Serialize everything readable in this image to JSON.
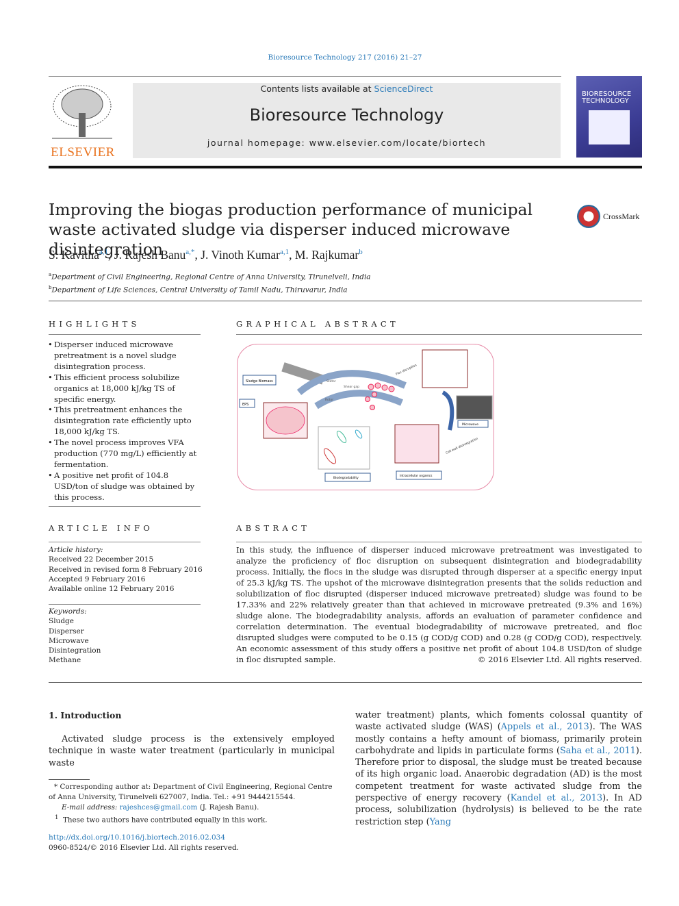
{
  "header": {
    "citation": "Bioresource Technology 217 (2016) 21–27",
    "contents_prefix": "Contents lists available at ",
    "contents_link": "ScienceDirect",
    "journal_title": "Bioresource Technology",
    "homepage": "journal homepage: www.elsevier.com/locate/biortech",
    "publisher_logo": "ELSEVIER",
    "cover_title": "BIORESOURCE TECHNOLOGY",
    "crossmark": "CrossMark"
  },
  "article": {
    "title": "Improving the biogas production performance of municipal waste activated sludge via disperser induced microwave disintegration",
    "authors": [
      {
        "name": "S. Kavitha",
        "sup": "a,1"
      },
      {
        "name": "J. Rajesh Banu",
        "sup": "a,*"
      },
      {
        "name": "J. Vinoth Kumar",
        "sup": "a,1"
      },
      {
        "name": "M. Rajkumar",
        "sup": "b"
      }
    ],
    "affiliations": [
      {
        "mark": "a",
        "text": "Department of Civil Engineering, Regional Centre of Anna University, Tirunelveli, India"
      },
      {
        "mark": "b",
        "text": "Department of Life Sciences, Central University of Tamil Nadu, Thiruvarur, India"
      }
    ]
  },
  "highlights": {
    "heading": "HIGHLIGHTS",
    "items": [
      "Disperser induced microwave pretreatment is a novel sludge disintegration process.",
      "This efficient process solubilize organics at 18,000 kJ/kg TS of specific energy.",
      "This pretreatment enhances the disintegration rate efficiently upto 18,000 kJ/kg TS.",
      "The novel process improves VFA production (770 mg/L) efficiently at fermentation.",
      "A positive net profit of 104.8 USD/ton of sludge was obtained by this process."
    ]
  },
  "graphical_abstract": {
    "heading": "GRAPHICAL ABSTRACT",
    "labels": {
      "sludge": "Sludge Biomass",
      "eps": "EPS",
      "stator": "Stator",
      "shear": "Shear gap",
      "rotor": "Rotor",
      "floc": "Floc disruption",
      "microwave": "Microwave",
      "intra": "Intracellular organics",
      "biodeg": "Biodegradability",
      "cell": "Cell wall disintegration"
    }
  },
  "article_info": {
    "heading": "ARTICLE INFO",
    "history_label": "Article history:",
    "history": [
      "Received 22 December 2015",
      "Received in revised form 8 February 2016",
      "Accepted 9 February 2016",
      "Available online 12 February 2016"
    ],
    "keywords_label": "Keywords:",
    "keywords": [
      "Sludge",
      "Disperser",
      "Microwave",
      "Disintegration",
      "Methane"
    ]
  },
  "abstract": {
    "heading": "ABSTRACT",
    "text": "In this study, the influence of disperser induced microwave pretreatment was investigated to analyze the proficiency of floc disruption on subsequent disintegration and biodegradability process. Initially, the flocs in the sludge was disrupted through disperser at a specific energy input of 25.3 kJ/kg TS. The upshot of the microwave disintegration presents that the solids reduction and solubilization of floc disrupted (disperser induced microwave pretreated) sludge was found to be 17.33% and 22% relatively greater than that achieved in microwave pretreated (9.3% and 16%) sludge alone. The biodegradability analysis, affords an evaluation of parameter confidence and correlation determination. The eventual biodegradability of microwave pretreated, and floc disrupted sludges were computed to be 0.15 (g COD/g COD) and 0.28 (g COD/g COD), respectively. An economic assessment of this study offers a positive net profit of about 104.8 USD/ton of sludge in floc disrupted sample.",
    "copyright": "© 2016 Elsevier Ltd. All rights reserved."
  },
  "introduction": {
    "heading": "1. Introduction",
    "left": "Activated sludge process is the extensively employed technique in waste water treatment (particularly in municipal waste",
    "right_parts": [
      {
        "t": "water treatment) plants, which foments colossal quantity of waste activated sludge (WAS) ("
      },
      {
        "t": "Appels et al., 2013",
        "link": true
      },
      {
        "t": "). The WAS mostly contains a hefty amount of biomass, primarily protein carbohydrate and lipids in particulate forms ("
      },
      {
        "t": "Saha et al., 2011",
        "link": true
      },
      {
        "t": "). Therefore prior to disposal, the sludge must be treated because of its high organic load. Anaerobic degradation (AD) is the most competent treatment for waste activated sludge from the perspective of energy recovery ("
      },
      {
        "t": "Kandel et al., 2013",
        "link": true
      },
      {
        "t": "). In AD process, solubilization (hydrolysis) is believed to be the rate restriction step ("
      },
      {
        "t": "Yang",
        "link": true
      }
    ]
  },
  "footnotes": {
    "corresponding": "Corresponding author at: Department of Civil Engineering, Regional Centre of Anna University, Tirunelveli 627007, India. Tel.: +91 9444215544.",
    "corresponding_mark": "*",
    "email_label": "E-mail address:",
    "email": "rajeshces@gmail.com",
    "email_suffix": "(J. Rajesh Banu).",
    "equal_mark": "1",
    "equal": "These two authors have contributed equally in this work."
  },
  "doi": {
    "url": "http://dx.doi.org/10.1016/j.biortech.2016.02.034",
    "issn": "0960-8524/© 2016 Elsevier Ltd. All rights reserved."
  }
}
